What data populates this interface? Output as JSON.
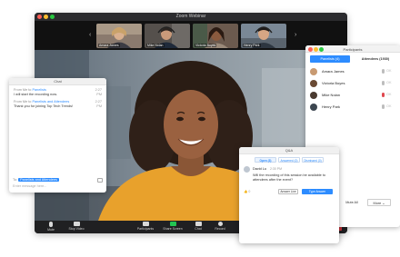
{
  "window": {
    "title": "Zoom Webinar"
  },
  "thumbnails": [
    {
      "name": "Amara James"
    },
    {
      "name": "Mike Nolan"
    },
    {
      "name": "Victoria Boyes"
    },
    {
      "name": "Henry Park"
    }
  ],
  "controls": [
    {
      "label": "Mute",
      "icon": "microphone-icon"
    },
    {
      "label": "Stop Video",
      "icon": "video-camera-icon"
    },
    {
      "label": "Participants",
      "icon": "participants-icon"
    },
    {
      "label": "Share Screen",
      "icon": "share-screen-icon"
    },
    {
      "label": "Chat",
      "icon": "chat-icon"
    },
    {
      "label": "Record",
      "icon": "record-icon"
    }
  ],
  "end_label": "End",
  "chat": {
    "title": "Chat",
    "messages": [
      {
        "from_prefix": "From Me to",
        "to": "Panelists",
        "time": "2:27 PM",
        "text": "I will start the recording now."
      },
      {
        "from_prefix": "From Me to",
        "to": "Panelists and Attendees",
        "time": "2:27 PM",
        "text": "Thank you for joining Top Tech Trends!"
      }
    ],
    "to_prefix": "To:",
    "to_value": "Panelists and Attendees",
    "input_placeholder": "Enter message here..."
  },
  "participants": {
    "title": "Participants",
    "tabs": [
      {
        "label": "Panelists (4)"
      },
      {
        "label": "Attendees (1930)"
      }
    ],
    "rows": [
      {
        "name": "Amara James",
        "muted": false,
        "status": "OK"
      },
      {
        "name": "Victoria Boyes",
        "muted": false,
        "status": "OK"
      },
      {
        "name": "Mike Nolan",
        "muted": true,
        "status": "OK"
      },
      {
        "name": "Henry Park",
        "muted": false,
        "status": "OK"
      }
    ],
    "mute_all_label": "Mute All",
    "more_label": "More ⌄"
  },
  "qa": {
    "title": "Q&A",
    "tabs": [
      {
        "label": "Open (3)"
      },
      {
        "label": "Answered (0)"
      },
      {
        "label": "Dismissed (0)"
      }
    ],
    "question": {
      "name": "David Lu",
      "time": "2:30 PM",
      "text": "Will the recording of this session be available to attendees after the event?",
      "likes": "👍 0"
    },
    "answer_live_label": "Answer Live",
    "type_answer_label": "Type Answer"
  },
  "colors": {
    "accent": "#2d8cff",
    "end": "#d8363f",
    "share": "#23c552"
  }
}
